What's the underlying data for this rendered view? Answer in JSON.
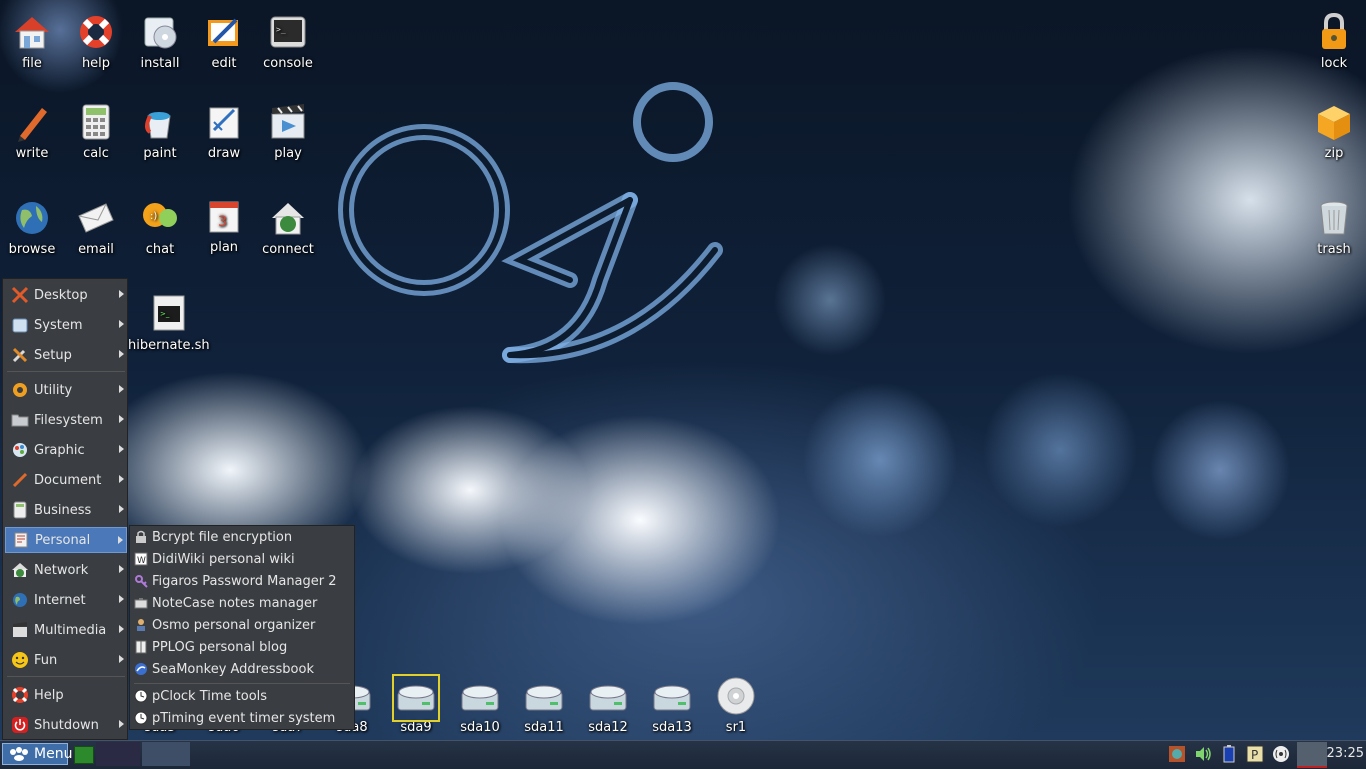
{
  "desktop_icons": {
    "file": "file",
    "help": "help",
    "install": "install",
    "edit": "edit",
    "console": "console",
    "write": "write",
    "calc": "calc",
    "paint": "paint",
    "draw": "draw",
    "play": "play",
    "browse": "browse",
    "email": "email",
    "chat": "chat",
    "plan": "plan",
    "connect": "connect",
    "hibernate": "hibernate.sh",
    "lock": "lock",
    "zip": "zip",
    "trash": "trash"
  },
  "drives": [
    "sda5",
    "sda6",
    "sda7",
    "sda8",
    "sda9",
    "sda10",
    "sda11",
    "sda12",
    "sda13",
    "sr1"
  ],
  "main_menu": {
    "items": [
      "Desktop",
      "System",
      "Setup",
      "Utility",
      "Filesystem",
      "Graphic",
      "Document",
      "Business",
      "Personal",
      "Network",
      "Internet",
      "Multimedia",
      "Fun",
      "Help",
      "Shutdown"
    ]
  },
  "personal_submenu": {
    "items": [
      "Bcrypt file encryption",
      "DidiWiki personal wiki",
      "Figaros Password Manager 2",
      "NoteCase notes manager",
      "Osmo personal organizer",
      "PPLOG personal blog",
      "SeaMonkey Addressbook",
      "pClock Time tools",
      "pTiming event timer system"
    ]
  },
  "taskbar": {
    "menu_label": "Menu",
    "clock": "23:25"
  },
  "colors": {
    "menu_bg": "#3a3d41",
    "menu_active": "#4a78b8",
    "taskbar": "#1c2738",
    "selected_drive": "#e3d12a"
  }
}
